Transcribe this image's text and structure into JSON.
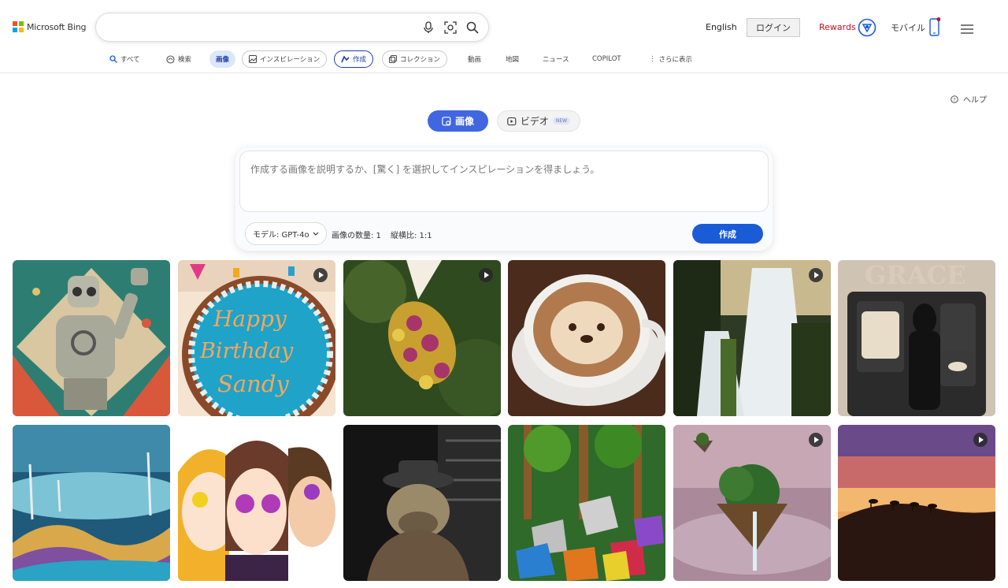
{
  "header": {
    "logo_text": "Microsoft Bing",
    "search_value": "",
    "lang": "English",
    "login": "ログイン",
    "rewards": "Rewards",
    "mobile": "モバイル"
  },
  "nav": {
    "all": "すべて",
    "search": "検索",
    "images": "画像",
    "inspiration": "インスピレーション",
    "create": "作成",
    "collection": "コレクション",
    "videos": "動画",
    "maps": "地図",
    "news": "ニュース",
    "copilot": "COPILOT",
    "more": "さらに表示"
  },
  "help": "ヘルプ",
  "tabs": {
    "image": "画像",
    "video": "ビデオ",
    "new_badge": "NEW"
  },
  "prompt": {
    "placeholder": "作成する画像を説明するか、[驚く] を選択してインスピレーションを得ましょう。",
    "model": "モデル: GPT-4o",
    "count": "画像の数量: 1",
    "ratio": "縦横比: 1:1",
    "create": "作成"
  },
  "gallery": {
    "cake_text_1": "Happy",
    "cake_text_2": "Birthday",
    "cake_text_3": "Sandy",
    "grace_text": "GRACE"
  },
  "colors": {
    "accent": "#4066e0",
    "create_button": "#1a5bd8",
    "rewards": "#c50f1f"
  }
}
